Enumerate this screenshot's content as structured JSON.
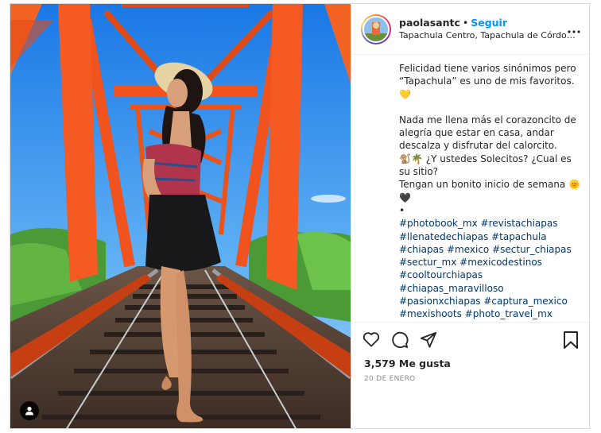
{
  "post": {
    "username": "paolasantc",
    "separator": "•",
    "follow_label": "Seguir",
    "location": "Tapachula Centro, Tapachula de Córdova y Ordóñez, Chiapas",
    "more_icon": "more-horizontal-icon"
  },
  "caption": {
    "line1": "Felicidad tiene varios sinónimos pero “Tapachula” es uno de mis favoritos. 💛",
    "line2": "Nada me llena más el corazoncito de alegría que estar en casa, andar descalza y disfrutar del calorcito.",
    "line3": "🐒🌴 ¿Y ustedes Solecitos? ¿Cual es su sitio?",
    "line4": "Tengan un bonito inicio de semana 🌞🖤",
    "line5": "•",
    "hashtags": [
      "#photobook_mx #revistachiapas",
      "#llenatedechiapas #tapachula",
      "#chiapas #mexico #sectur_chiapas",
      "#sectur_mx #mexicodestinos",
      "#cooltourchiapas",
      "#chiapas_maravilloso",
      "#pasionxchiapas #captura_mexico",
      "#mexishoots #photo_travel_mx"
    ]
  },
  "engagement": {
    "likes_text": "3,579 Me gusta",
    "date_text": "20 DE ENERO"
  },
  "colors": {
    "link": "#00376b",
    "follow": "#0095f6",
    "bridge": "#f0531d",
    "sky": "#2a8ef0"
  }
}
